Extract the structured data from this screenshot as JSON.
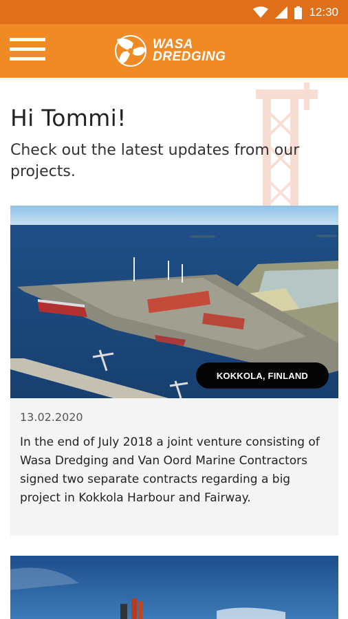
{
  "status_bar": {
    "time": "12:30"
  },
  "app_bar": {
    "logo_line1": "WASA",
    "logo_line2": "DREDGING"
  },
  "header": {
    "greeting": "Hi Tommi!",
    "subtitle": "Check out the latest updates from our projects."
  },
  "cards": [
    {
      "location": "KOKKOLA, FINLAND",
      "date": "13.02.2020",
      "text": "In the end of July 2018 a joint venture consisting of Wasa Dredging and Van Oord Marine Contractors signed two separate contracts regarding a big project in Kokkola Harbour and Fairway."
    }
  ],
  "icons": {
    "wifi": "wifi-icon",
    "signal": "signal-icon",
    "battery": "battery-icon",
    "menu": "menu-icon",
    "logo": "wasa-dredging-logo-icon"
  },
  "colors": {
    "status_bar": "#e06f1a",
    "app_bar": "#f08a24",
    "pill": "#050505"
  }
}
